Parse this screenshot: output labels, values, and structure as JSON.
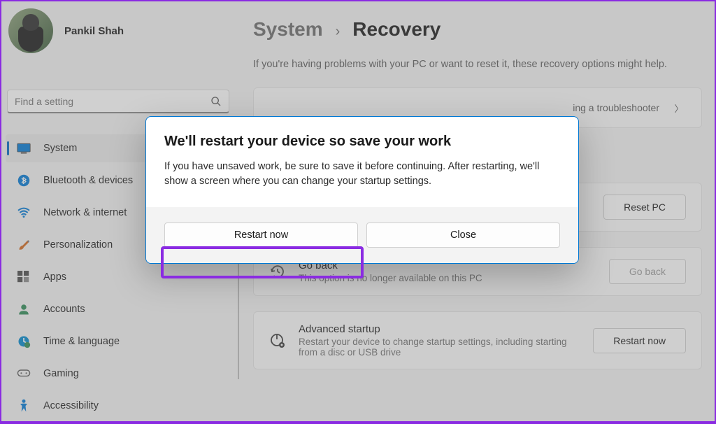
{
  "user": {
    "name": "Pankil Shah"
  },
  "search": {
    "placeholder": "Find a setting"
  },
  "sidebar": {
    "items": [
      {
        "label": "System"
      },
      {
        "label": "Bluetooth & devices"
      },
      {
        "label": "Network & internet"
      },
      {
        "label": "Personalization"
      },
      {
        "label": "Apps"
      },
      {
        "label": "Accounts"
      },
      {
        "label": "Time & language"
      },
      {
        "label": "Gaming"
      },
      {
        "label": "Accessibility"
      }
    ]
  },
  "breadcrumb": {
    "parent": "System",
    "sep": "›",
    "current": "Recovery"
  },
  "main": {
    "subtitle": "If you're having problems with your PC or want to reset it, these recovery options might help.",
    "troubleshoot": {
      "hint_fragment": "ing a troubleshooter"
    },
    "reset": {
      "button": "Reset PC"
    },
    "goback": {
      "title": "Go back",
      "desc": "This option is no longer available on this PC",
      "button": "Go back"
    },
    "advanced": {
      "title": "Advanced startup",
      "desc": "Restart your device to change startup settings, including starting from a disc or USB drive",
      "button": "Restart now"
    }
  },
  "modal": {
    "title": "We'll restart your device so save your work",
    "text": "If you have unsaved work, be sure to save it before continuing. After restarting, we'll show a screen where you can change your startup settings.",
    "primary": "Restart now",
    "secondary": "Close"
  }
}
